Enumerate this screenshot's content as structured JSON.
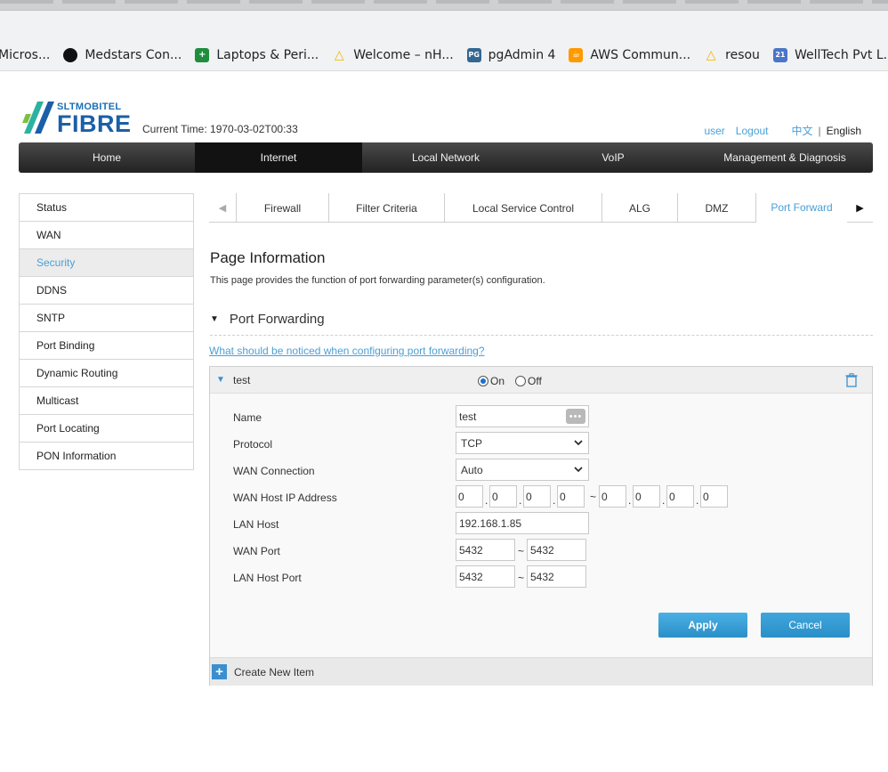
{
  "browser": {
    "bookmarks": [
      {
        "label": "Micros...",
        "icon": "microsoft-icon"
      },
      {
        "label": "Medstars Con...",
        "icon": "github-icon"
      },
      {
        "label": "Laptops & Peri...",
        "icon": "sheet-icon"
      },
      {
        "label": "Welcome – nH...",
        "icon": "drive-icon"
      },
      {
        "label": "pgAdmin 4",
        "icon": "pgadmin-icon"
      },
      {
        "label": "AWS Commun...",
        "icon": "aws-icon"
      },
      {
        "label": "resou",
        "icon": "drive-icon"
      },
      {
        "label": "WellTech Pvt L...",
        "icon": "calendar-icon"
      }
    ],
    "icon_glyphs": {
      "gh": "●",
      "sheet": "+",
      "drive": "△",
      "pg": "PG",
      "aws": "☕",
      "cal": "21"
    }
  },
  "header": {
    "logo_top": "SLTMOBITEL",
    "logo_main": "FIBRE",
    "current_time": "Current Time: 1970-03-02T00:33",
    "user_link": "user",
    "logout_link": "Logout",
    "lang_cn": "中文",
    "lang_sep": "|",
    "lang_en": "English"
  },
  "nav": {
    "items": [
      "Home",
      "Internet",
      "Local Network",
      "VoIP",
      "Management & Diagnosis"
    ],
    "active": "Internet"
  },
  "sidebar": {
    "items": [
      "Status",
      "WAN",
      "Security",
      "DDNS",
      "SNTP",
      "Port Binding",
      "Dynamic Routing",
      "Multicast",
      "Port Locating",
      "PON Information"
    ],
    "active": "Security"
  },
  "subtabs": {
    "items": [
      "Firewall",
      "Filter Criteria",
      "Local Service Control",
      "ALG",
      "DMZ",
      "Port Forward"
    ],
    "active": "Port Forward",
    "left_arrow": "◀",
    "right_arrow": "▶"
  },
  "content": {
    "page_title": "Page Information",
    "page_desc": "This page provides the function of port forwarding parameter(s) configuration.",
    "section_title": "Port Forwarding",
    "section_arrow": "▼",
    "notice_link": "What should be noticed when configuring port forwarding?"
  },
  "entry": {
    "name": "test",
    "arrow": "▼",
    "on_label": "On",
    "off_label": "Off",
    "enabled": true,
    "fields": {
      "name_label": "Name",
      "name_value": "test",
      "name_btn": "•••",
      "protocol_label": "Protocol",
      "protocol_value": "TCP",
      "wan_conn_label": "WAN Connection",
      "wan_conn_value": "Auto",
      "wan_ip_label": "WAN Host IP Address",
      "wan_ip_start": [
        "0",
        "0",
        "0",
        "0"
      ],
      "wan_ip_end": [
        "0",
        "0",
        "0",
        "0"
      ],
      "lan_host_label": "LAN Host",
      "lan_host_value": "192.168.1.85",
      "wan_port_label": "WAN Port",
      "wan_port_start": "5432",
      "wan_port_end": "5432",
      "lan_port_label": "LAN Host Port",
      "lan_port_start": "5432",
      "lan_port_end": "5432"
    },
    "apply_label": "Apply",
    "cancel_label": "Cancel"
  },
  "footer": {
    "create_label": "Create New Item",
    "plus": "+"
  },
  "glyphs": {
    "dot": ".",
    "tilde": "~",
    "chevron": "⌄"
  }
}
